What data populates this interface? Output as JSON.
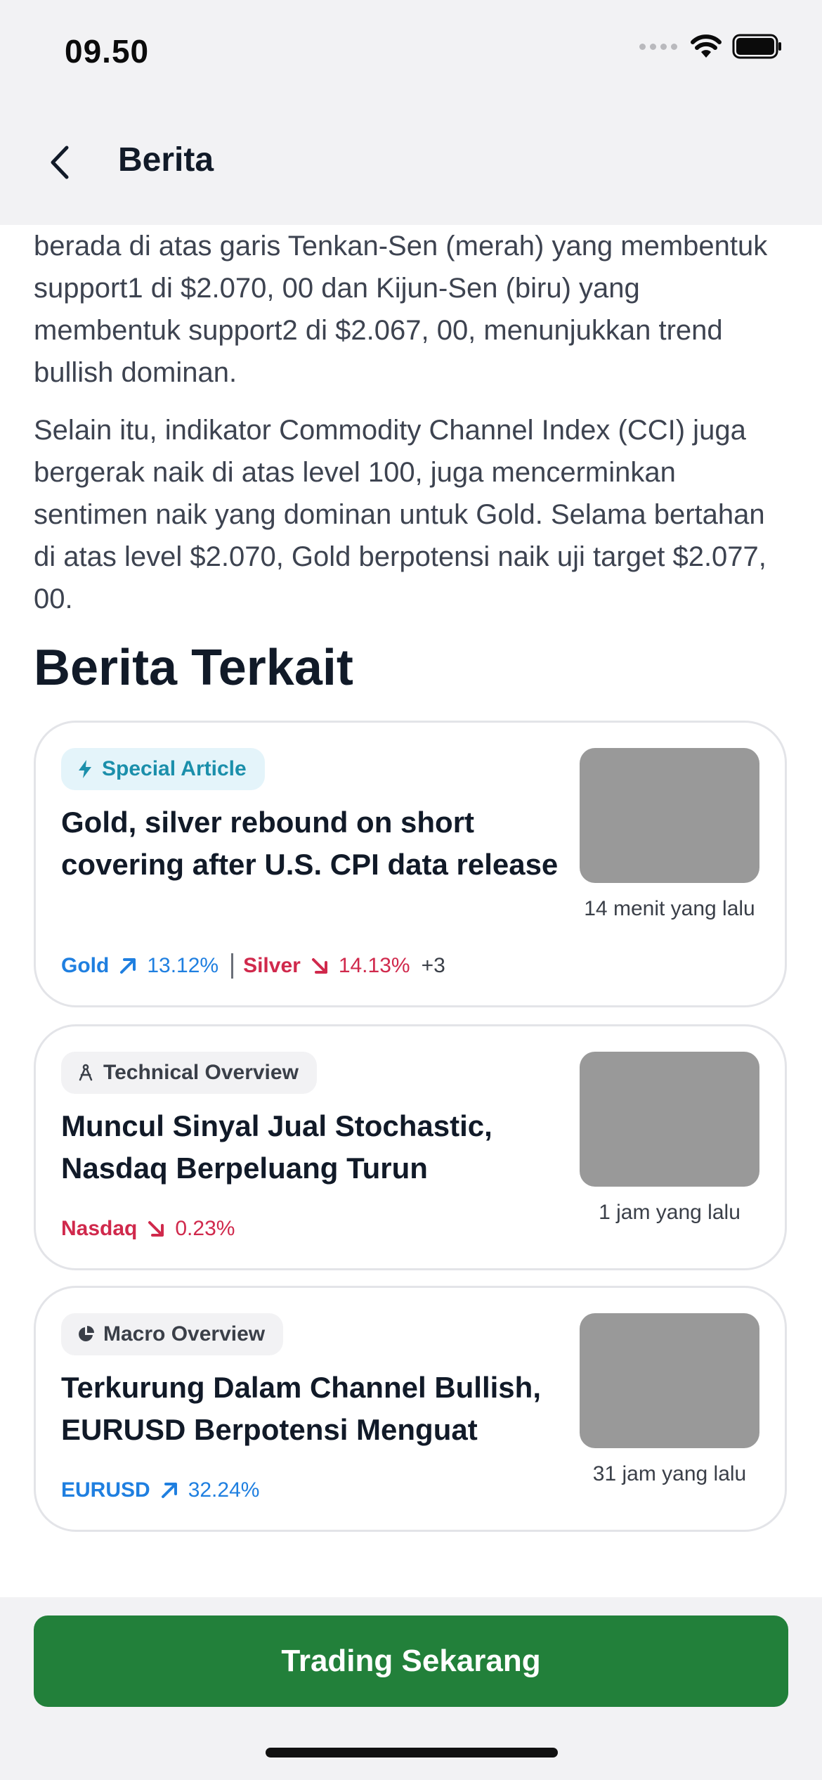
{
  "status_bar": {
    "time": "09.50"
  },
  "header": {
    "title": "Berita"
  },
  "article": {
    "paragraph_1": "berada di atas garis Tenkan-Sen (merah) yang membentuk support1 di $2.070, 00 dan Kijun-Sen (biru) yang membentuk support2 di $2.067, 00, menunjukkan trend bullish dominan.",
    "paragraph_2": "Selain itu, indikator Commodity Channel Index (CCI) juga bergerak naik di atas level 100, juga mencerminkan sentimen naik yang dominan untuk Gold. Selama bertahan di atas level $2.070, Gold berpotensi naik uji target $2.077, 00."
  },
  "related": {
    "title": "Berita Terkait",
    "cards": [
      {
        "badge": "Special Article",
        "badge_icon": "lightning-icon",
        "title": "Gold, silver rebound on short covering after U.S. CPI data release",
        "time": "14 menit yang lalu",
        "tickers": [
          {
            "name": "Gold",
            "direction": "up",
            "change": "13.12%"
          },
          {
            "name": "Silver",
            "direction": "down",
            "change": "14.13%"
          }
        ],
        "more": "+3"
      },
      {
        "badge": "Technical Overview",
        "badge_icon": "compass-icon",
        "title": "Muncul Sinyal Jual Stochastic, Nasdaq Berpeluang Turun",
        "time": "1 jam yang lalu",
        "tickers": [
          {
            "name": "Nasdaq",
            "direction": "down",
            "change": "0.23%"
          }
        ]
      },
      {
        "badge": "Macro Overview",
        "badge_icon": "pie-chart-icon",
        "title": "Terkurung Dalam Channel Bullish, EURUSD Berpotensi Menguat",
        "time": "31 jam yang lalu",
        "tickers": [
          {
            "name": "EURUSD",
            "direction": "up",
            "change": "32.24%"
          }
        ]
      }
    ]
  },
  "cta": {
    "label": "Trading Sekarang"
  },
  "colors": {
    "up": "#1f7fe0",
    "down": "#d0294c",
    "cta": "#22803a",
    "special_badge_bg": "#e4f4fa",
    "special_badge_text": "#1b8fab"
  }
}
